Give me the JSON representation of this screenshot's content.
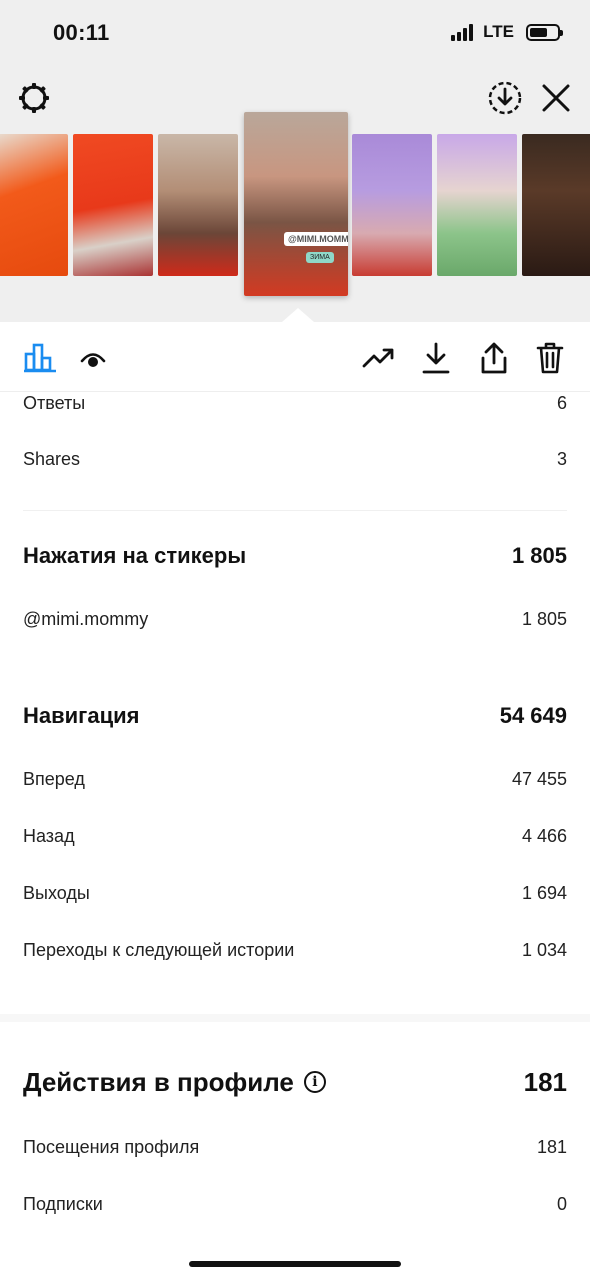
{
  "status_bar": {
    "time": "00:11",
    "network": "LTE",
    "signal_icon": "signal-bars-icon",
    "battery_icon": "battery-icon"
  },
  "header": {
    "left_icon": "gear-icon",
    "right_icons": [
      "download-circle-icon",
      "close-icon"
    ]
  },
  "toolbar": {
    "left_icons": [
      "bar-chart-icon",
      "eye-icon"
    ],
    "right_icons": [
      "trending-up-icon",
      "download-icon",
      "share-icon",
      "trash-icon"
    ],
    "accent": "#1a8cf0"
  },
  "stats": {
    "replies": {
      "label": "Ответы",
      "value": "6"
    },
    "shares": {
      "label": "Shares",
      "value": "3"
    },
    "sticker_taps": {
      "title": "Нажатия на стикеры",
      "total": "1 805",
      "items": [
        {
          "label": "@mimi.mommy",
          "value": "1 805"
        }
      ]
    },
    "navigation": {
      "title": "Навигация",
      "total": "54 649",
      "items": [
        {
          "label": "Вперед",
          "value": "47 455"
        },
        {
          "label": "Назад",
          "value": "4 466"
        },
        {
          "label": "Выходы",
          "value": "1 694"
        },
        {
          "label": "Переходы к следующей истории",
          "value": "1 034"
        }
      ]
    },
    "profile_actions": {
      "title": "Действия в профиле",
      "total": "181",
      "items": [
        {
          "label": "Посещения профиля",
          "value": "181"
        },
        {
          "label": "Подписки",
          "value": "0"
        }
      ]
    }
  },
  "thumbnails": {
    "selected_sticker": "@MIMI.MOMMY",
    "selected_caption": "ЗИМА"
  }
}
